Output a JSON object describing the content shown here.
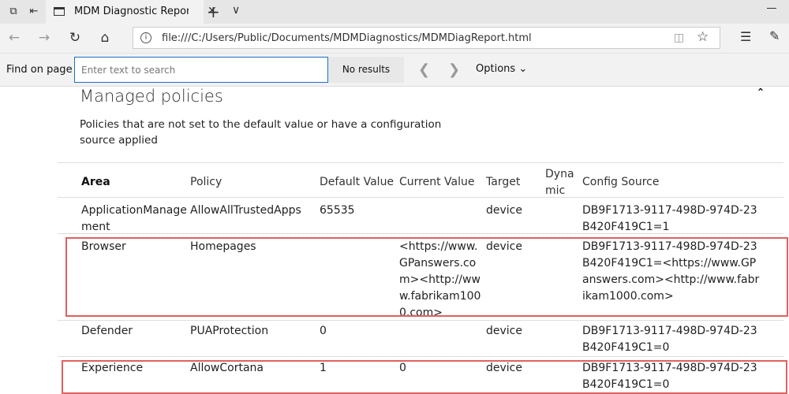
{
  "tab": {
    "title": "MDM Diagnostic Repor"
  },
  "address": {
    "url": "file:///C:/Users/Public/Documents/MDMDiagnostics/MDMDiagReport.html"
  },
  "find": {
    "label": "Find on page",
    "placeholder": "Enter text to search",
    "results": "No results",
    "options": "Options"
  },
  "section": {
    "title": "Managed policies",
    "description": "Policies that are not set to the default value or have a configuration source applied"
  },
  "table": {
    "headers": {
      "area": "Area",
      "policy": "Policy",
      "default_value": "Default Value",
      "current_value": "Current Value",
      "target": "Target",
      "dynamic": "Dynamic",
      "config_source": "Config Source"
    },
    "rows": [
      {
        "area": "ApplicationManagement",
        "policy": "AllowAllTrustedApps",
        "default_value": "65535",
        "current_value": "",
        "target": "device",
        "dynamic": "",
        "config_source": "DB9F1713-9117-498D-974D-23B420F419C1=1"
      },
      {
        "area": "Browser",
        "policy": "Homepages",
        "default_value": "",
        "current_value": "<https://www.GPanswers.com><http://www.fabrikam1000.com>",
        "target": "device",
        "dynamic": "",
        "config_source": "DB9F1713-9117-498D-974D-23B420F419C1=<https://www.GPanswers.com><http://www.fabrikam1000.com>"
      },
      {
        "area": "Defender",
        "policy": "PUAProtection",
        "default_value": "0",
        "current_value": "",
        "target": "device",
        "dynamic": "",
        "config_source": "DB9F1713-9117-498D-974D-23B420F419C1=0"
      },
      {
        "area": "Experience",
        "policy": "AllowCortana",
        "default_value": "1",
        "current_value": "0",
        "target": "device",
        "dynamic": "",
        "config_source": "DB9F1713-9117-498D-974D-23B420F419C1=0"
      }
    ]
  },
  "colors": {
    "highlight": "#e06060",
    "find_focus": "#1a6fc7"
  },
  "icons": [
    "tab-set-aside-icon",
    "tab-preview-icon",
    "page-icon",
    "close-icon",
    "new-tab-icon",
    "tab-list-icon",
    "minimize-icon",
    "back-icon",
    "forward-icon",
    "refresh-icon",
    "home-icon",
    "site-info-icon",
    "reading-view-icon",
    "favorite-star-icon",
    "hub-icon",
    "web-note-icon",
    "find-previous-icon",
    "find-next-icon",
    "chevron-down-icon",
    "collapse-caret-icon"
  ]
}
